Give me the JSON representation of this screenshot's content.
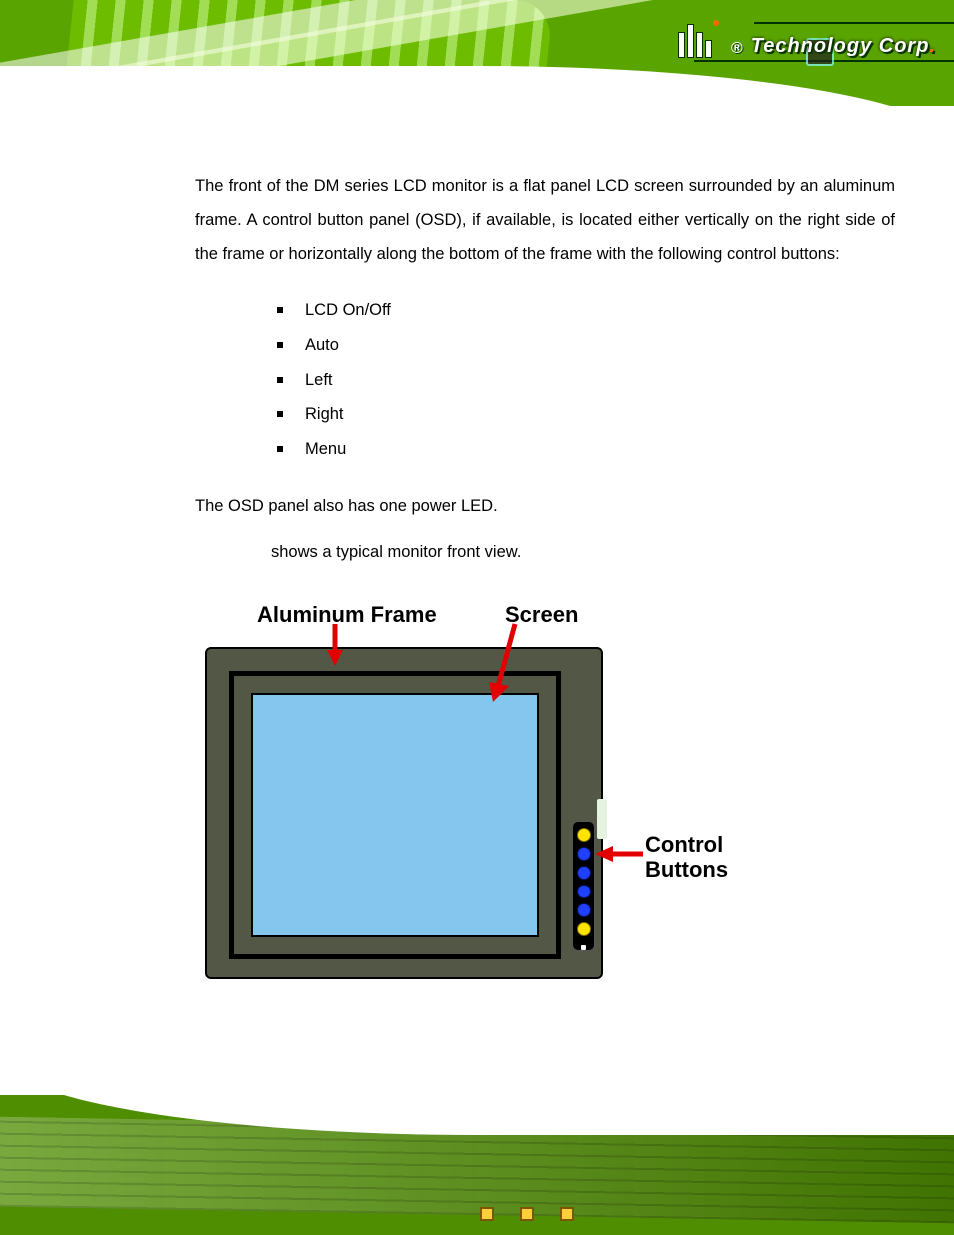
{
  "brand": {
    "reg": "®",
    "text": "Technology Corp",
    "dot": "."
  },
  "body": {
    "p1": "The front of the DM series LCD monitor is a flat panel LCD screen surrounded by an aluminum frame. A control button panel (OSD), if available, is located either vertically on the right side of the frame or horizontally along the bottom of the frame with the following control buttons:",
    "bullets": [
      "LCD On/Off",
      "Auto",
      "Left",
      "Right",
      "Menu"
    ],
    "p2": "The OSD panel also has one power LED.",
    "p3": "shows a typical monitor front view."
  },
  "figure": {
    "label_frame": "Aluminum Frame",
    "label_screen": "Screen",
    "label_buttons_l1": "Control",
    "label_buttons_l2": "Buttons"
  }
}
